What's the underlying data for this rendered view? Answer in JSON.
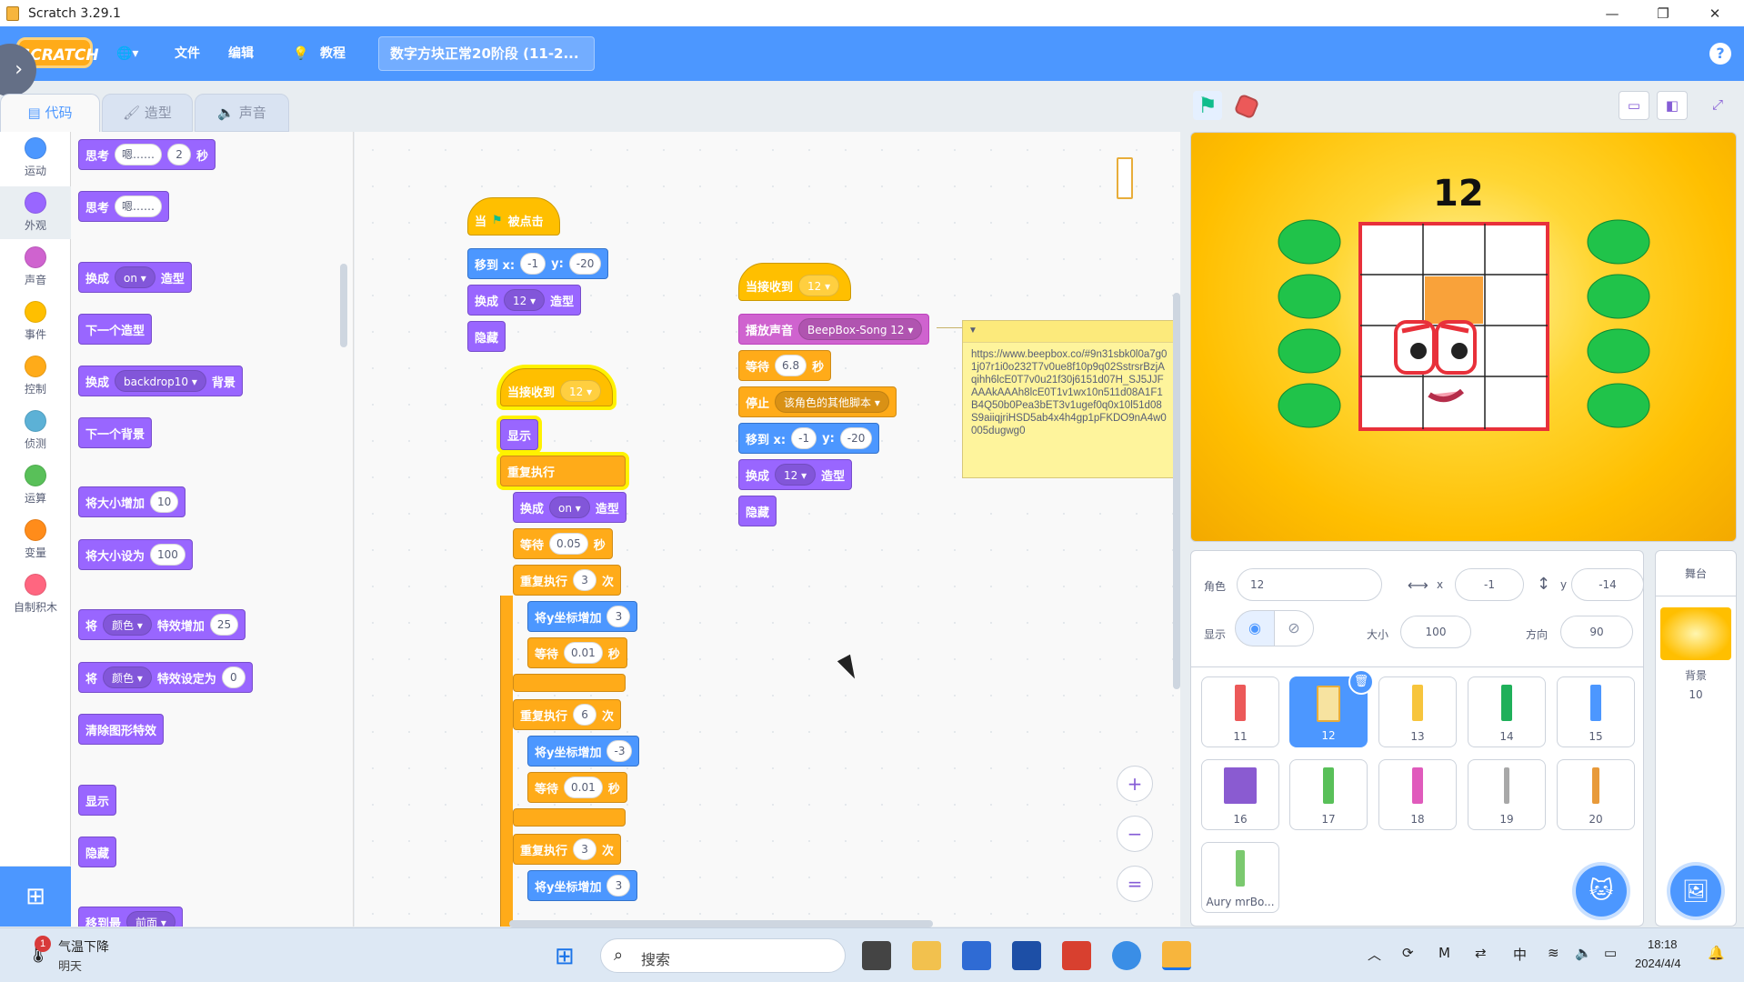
{
  "window": {
    "title": "Scratch 3.29.1",
    "min": "—",
    "max": "❐",
    "close": "✕"
  },
  "menubar": {
    "logo": "SCRATCH",
    "globe": "🌐▾",
    "file": "文件",
    "edit": "编辑",
    "tutorials": "教程",
    "project_title": "数字方块正常20阶段 (11-2...",
    "help": "?"
  },
  "tabs": [
    {
      "label": "代码",
      "icon": "code-icon",
      "active": true
    },
    {
      "label": "造型",
      "icon": "brush-icon",
      "active": false
    },
    {
      "label": "声音",
      "icon": "speaker-icon",
      "active": false
    }
  ],
  "categories": [
    {
      "label": "运动",
      "color": "#4c97ff"
    },
    {
      "label": "外观",
      "color": "#9966ff"
    },
    {
      "label": "声音",
      "color": "#cf63cf"
    },
    {
      "label": "事件",
      "color": "#ffbf00"
    },
    {
      "label": "控制",
      "color": "#ffab19"
    },
    {
      "label": "侦测",
      "color": "#5cb1d6"
    },
    {
      "label": "运算",
      "color": "#59c059"
    },
    {
      "label": "变量",
      "color": "#ff8c1a"
    },
    {
      "label": "自制积木",
      "color": "#ff6680"
    }
  ],
  "palette": {
    "think_secs": {
      "a": "思考",
      "msg": "嗯……",
      "secs": "2",
      "b": "秒"
    },
    "think": {
      "a": "思考",
      "msg": "嗯……"
    },
    "switch_costume": {
      "a": "换成",
      "val": "on ▾",
      "b": "造型"
    },
    "next_costume": "下一个造型",
    "switch_backdrop": {
      "a": "换成",
      "val": "backdrop10 ▾",
      "b": "背景"
    },
    "next_backdrop": "下一个背景",
    "change_size": {
      "a": "将大小增加",
      "val": "10"
    },
    "set_size": {
      "a": "将大小设为",
      "val": "100"
    },
    "change_effect": {
      "a": "将",
      "eff": "颜色 ▾",
      "b": "特效增加",
      "val": "25"
    },
    "set_effect": {
      "a": "将",
      "eff": "颜色 ▾",
      "b": "特效设定为",
      "val": "0"
    },
    "clear_effects": "清除图形特效",
    "show": "显示",
    "hide": "隐藏",
    "goto_layer": {
      "a": "移到最",
      "val": "前面 ▾"
    }
  },
  "script1": {
    "hat": {
      "a": "当",
      "b": "被点击"
    },
    "goto": {
      "a": "移到 x:",
      "x": "-1",
      "b": "y:",
      "y": "-20"
    },
    "costume": {
      "a": "换成",
      "val": "12 ▾",
      "b": "造型"
    },
    "hide": "隐藏"
  },
  "script2": {
    "hat": {
      "a": "当接收到",
      "val": "12 ▾"
    },
    "show": "显示",
    "forever": "重复执行",
    "costume": {
      "a": "换成",
      "val": "on ▾",
      "b": "造型"
    },
    "wait1": {
      "a": "等待",
      "val": "0.05",
      "b": "秒"
    },
    "rep1": {
      "a": "重复执行",
      "val": "3",
      "b": "次"
    },
    "chy1": {
      "a": "将y坐标增加",
      "val": "3"
    },
    "wait2": {
      "a": "等待",
      "val": "0.01",
      "b": "秒"
    },
    "rep2": {
      "a": "重复执行",
      "val": "6",
      "b": "次"
    },
    "chy2": {
      "a": "将y坐标增加",
      "val": "-3"
    },
    "wait3": {
      "a": "等待",
      "val": "0.01",
      "b": "秒"
    },
    "rep3": {
      "a": "重复执行",
      "val": "3",
      "b": "次"
    },
    "chy3": {
      "a": "将y坐标增加",
      "val": "3"
    }
  },
  "script3": {
    "hat": {
      "a": "当接收到",
      "val": "12 ▾"
    },
    "sound": {
      "a": "播放声音",
      "val": "BeepBox-Song 12 ▾"
    },
    "wait": {
      "a": "等待",
      "val": "6.8",
      "b": "秒"
    },
    "stop": {
      "a": "停止",
      "val": "该角色的其他脚本 ▾"
    },
    "goto": {
      "a": "移到 x:",
      "x": "-1",
      "b": "y:",
      "y": "-20"
    },
    "costume": {
      "a": "换成",
      "val": "12 ▾",
      "b": "造型"
    },
    "hide": "隐藏"
  },
  "comment": {
    "text": "https://www.beepbox.co/#9n31sbk0l0a7g01j07r1i0o232T7v0ue8f10p9q02SstrsrBzjAqihh6lcE0T7v0u21f30j6151d07H_SJ5JJFAAAkAAAh8lcE0T1v1wx10n511d08A1F1B4Q50b0Pea3bET3v1ugef0q0x10l51d08S9aiiqjriHSD5ab4x4h4gp1pFKDO9nA4w0005dugwg0"
  },
  "zoom": {
    "in": "+",
    "out": "−",
    "reset": "="
  },
  "stage": {
    "number": "12"
  },
  "sprite_info": {
    "sprite_label": "角色",
    "sprite_name": "12",
    "x_label": "x",
    "x": "-1",
    "y_label": "y",
    "y": "-14",
    "show_label": "显示",
    "size_label": "大小",
    "size": "100",
    "dir_label": "方向",
    "dir": "90"
  },
  "sprites": [
    {
      "name": "11",
      "color": "#ec5959"
    },
    {
      "name": "12",
      "color": "#e8ad3a"
    },
    {
      "name": "13",
      "color": "#f7c53d"
    },
    {
      "name": "14",
      "color": "#1fb05a"
    },
    {
      "name": "15",
      "color": "#4c97ff"
    },
    {
      "name": "16",
      "color": "#8a5bd1"
    },
    {
      "name": "17",
      "color": "#59c059"
    },
    {
      "name": "18",
      "color": "#e05bbc"
    },
    {
      "name": "19",
      "color": "#a8a8a8"
    },
    {
      "name": "20",
      "color": "#e89a3a"
    },
    {
      "name": "Aury mrBo...",
      "color": "#7bc96f"
    }
  ],
  "stage_panel": {
    "title": "舞台",
    "backdrop_label": "背景",
    "backdrop_count": "10"
  },
  "taskbar": {
    "weather_badge": "1",
    "weather_title": "气温下降",
    "weather_sub": "明天",
    "search": "搜索",
    "ime": "中",
    "time": "18:18",
    "date": "2024/4/4"
  }
}
